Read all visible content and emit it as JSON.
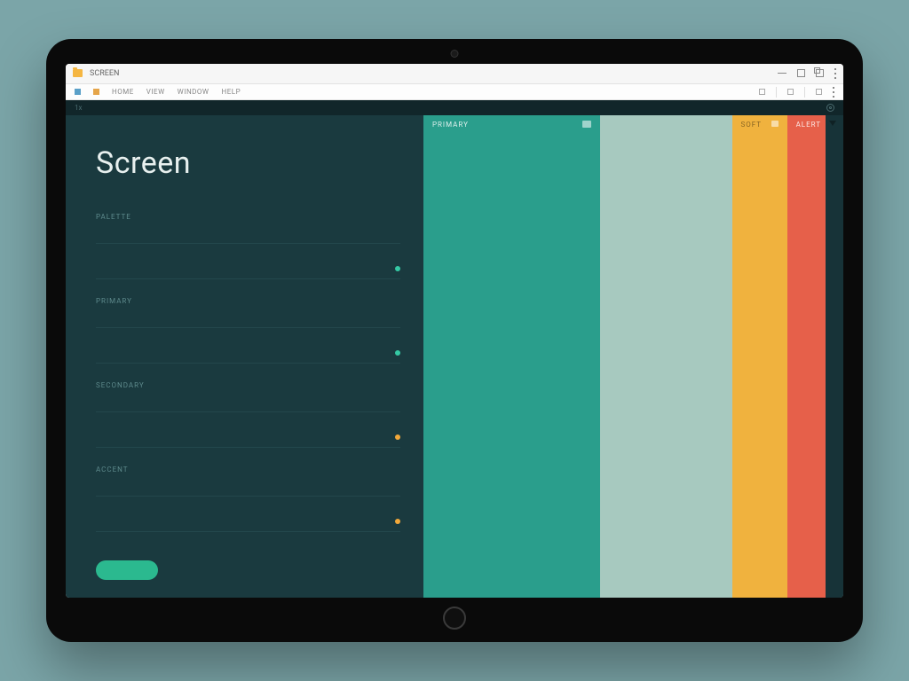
{
  "browser": {
    "title": "SCREEN"
  },
  "menubar": {
    "items": [
      "HOME",
      "VIEW",
      "WINDOW",
      "HELP"
    ]
  },
  "apptop": {
    "left": "1x",
    "right": ""
  },
  "page": {
    "title": "Screen"
  },
  "fields": [
    {
      "label": "PALETTE",
      "value": "",
      "dot": ""
    },
    {
      "label": "",
      "value": "",
      "dot": "teal"
    },
    {
      "label": "PRIMARY",
      "value": "",
      "dot": ""
    },
    {
      "label": "",
      "value": "",
      "dot": "teal"
    },
    {
      "label": "SECONDARY",
      "value": "",
      "dot": ""
    },
    {
      "label": "",
      "value": "",
      "dot": "amber"
    },
    {
      "label": "ACCENT",
      "value": "",
      "dot": ""
    },
    {
      "label": "",
      "value": "",
      "dot": "amber"
    }
  ],
  "swatches": [
    {
      "label": "PRIMARY",
      "color": "#2a9e8c",
      "text": "light",
      "icon": true
    },
    {
      "label": "",
      "color": "#a7c9bf",
      "text": "dark",
      "icon": false
    },
    {
      "label": "SOFT",
      "color": "#f0b23e",
      "text": "dark",
      "icon": false
    },
    {
      "label": "ALERT",
      "color": "#e6604a",
      "text": "light",
      "icon": false
    },
    {
      "label": "",
      "color": "#173338",
      "text": "light",
      "icon": false
    }
  ],
  "colors": {
    "bg": "#7ba5a8",
    "panel": "#1a3a3f",
    "accent": "#2bb98f"
  }
}
